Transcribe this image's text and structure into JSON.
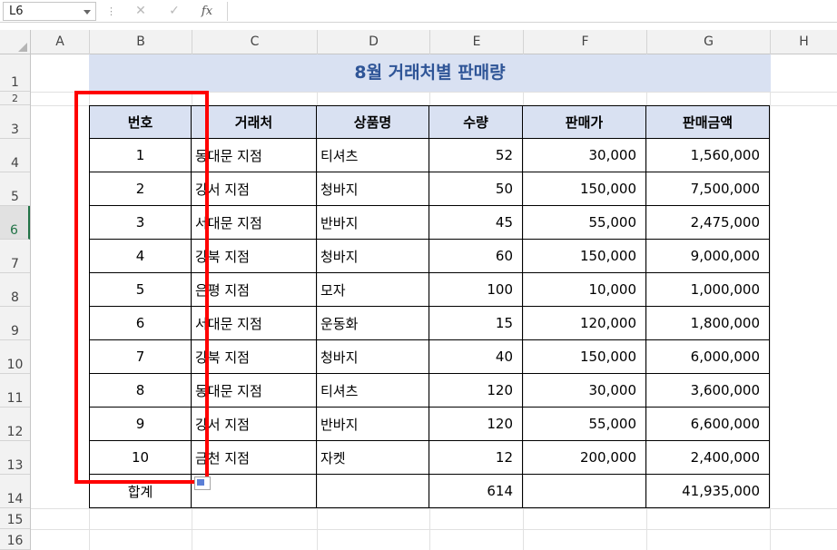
{
  "formula_bar": {
    "name_box": "L6",
    "more_icon": "more-vertical-icon",
    "cancel_icon": "close-icon",
    "enter_icon": "check-icon",
    "fx_label": "fx"
  },
  "columns": [
    "A",
    "B",
    "C",
    "D",
    "E",
    "F",
    "G",
    "H"
  ],
  "rows": [
    "1",
    "2",
    "3",
    "4",
    "5",
    "6",
    "7",
    "8",
    "9",
    "10",
    "11",
    "12",
    "13",
    "14",
    "15",
    "16"
  ],
  "active_row": "6",
  "title": "8월 거래처별 판매량",
  "table": {
    "headers": [
      "번호",
      "거래처",
      "상품명",
      "수량",
      "판매가",
      "판매금액"
    ],
    "rows": [
      [
        "1",
        "동대문 지점",
        "티셔츠",
        "52",
        "30,000",
        "1,560,000"
      ],
      [
        "2",
        "강서 지점",
        "청바지",
        "50",
        "150,000",
        "7,500,000"
      ],
      [
        "3",
        "서대문 지점",
        "반바지",
        "45",
        "55,000",
        "2,475,000"
      ],
      [
        "4",
        "강북 지점",
        "청바지",
        "60",
        "150,000",
        "9,000,000"
      ],
      [
        "5",
        "은평 지점",
        "모자",
        "100",
        "10,000",
        "1,000,000"
      ],
      [
        "6",
        "서대문 지점",
        "운동화",
        "15",
        "120,000",
        "1,800,000"
      ],
      [
        "7",
        "강북 지점",
        "청바지",
        "40",
        "150,000",
        "6,000,000"
      ],
      [
        "8",
        "동대문 지점",
        "티셔츠",
        "120",
        "30,000",
        "3,600,000"
      ],
      [
        "9",
        "강서 지점",
        "반바지",
        "120",
        "55,000",
        "6,600,000"
      ],
      [
        "10",
        "금천 지점",
        "자켓",
        "12",
        "200,000",
        "2,400,000"
      ]
    ],
    "total": [
      "합계",
      "",
      "",
      "614",
      "",
      "41,935,000"
    ]
  },
  "colors": {
    "title_bg": "#d9e1f2",
    "title_text": "#2f5597",
    "header_bg": "#d9e1f2",
    "highlight_box": "#ff0000",
    "active_row": "#217346"
  }
}
